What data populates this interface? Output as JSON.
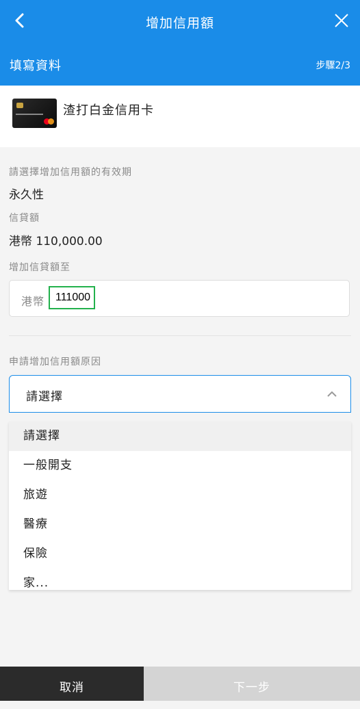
{
  "header": {
    "title": "增加信用額",
    "step_title": "填寫資料",
    "step_count": "步驟2/3"
  },
  "card": {
    "name": "渣打白金信用卡"
  },
  "validity": {
    "label": "請選擇增加信用額的有效期",
    "value": "永久性"
  },
  "credit_limit": {
    "label": "信貸額",
    "value": "港幣 110,000.00"
  },
  "increase_to": {
    "label": "增加信貸額至",
    "prefix": "港幣",
    "value": "111000"
  },
  "reason": {
    "label": "申請增加信用額原因",
    "selected": "請選擇",
    "options": [
      "請選擇",
      "一般開支",
      "旅遊",
      "醫療",
      "保險",
      "家..."
    ]
  },
  "footer": {
    "cancel": "取消",
    "next": "下一步"
  },
  "colors": {
    "brand": "#1a8ce8",
    "highlight": "#22b14c"
  }
}
